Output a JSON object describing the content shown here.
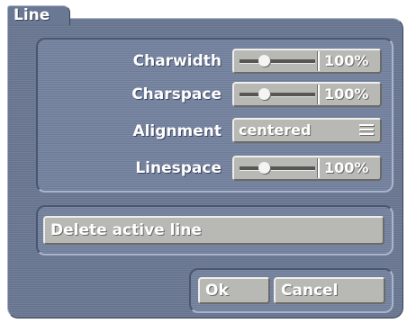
{
  "window": {
    "title": "Line"
  },
  "settings": {
    "charwidth": {
      "label": "Charwidth",
      "value": "100%",
      "level": 0.33
    },
    "charspace": {
      "label": "Charspace",
      "value": "100%",
      "level": 0.33
    },
    "alignment": {
      "label": "Alignment",
      "value": "centered"
    },
    "linespace": {
      "label": "Linespace",
      "value": "100%",
      "level": 0.33
    }
  },
  "actions": {
    "delete_line": "Delete active line",
    "ok": "Ok",
    "cancel": "Cancel"
  },
  "colors": {
    "panel": "#6b7893",
    "control": "#b8b8b4",
    "text": "#ffffff"
  },
  "icons": {
    "select_menu": "menu-lines-icon",
    "slider_handle": "slider-knob-icon"
  }
}
